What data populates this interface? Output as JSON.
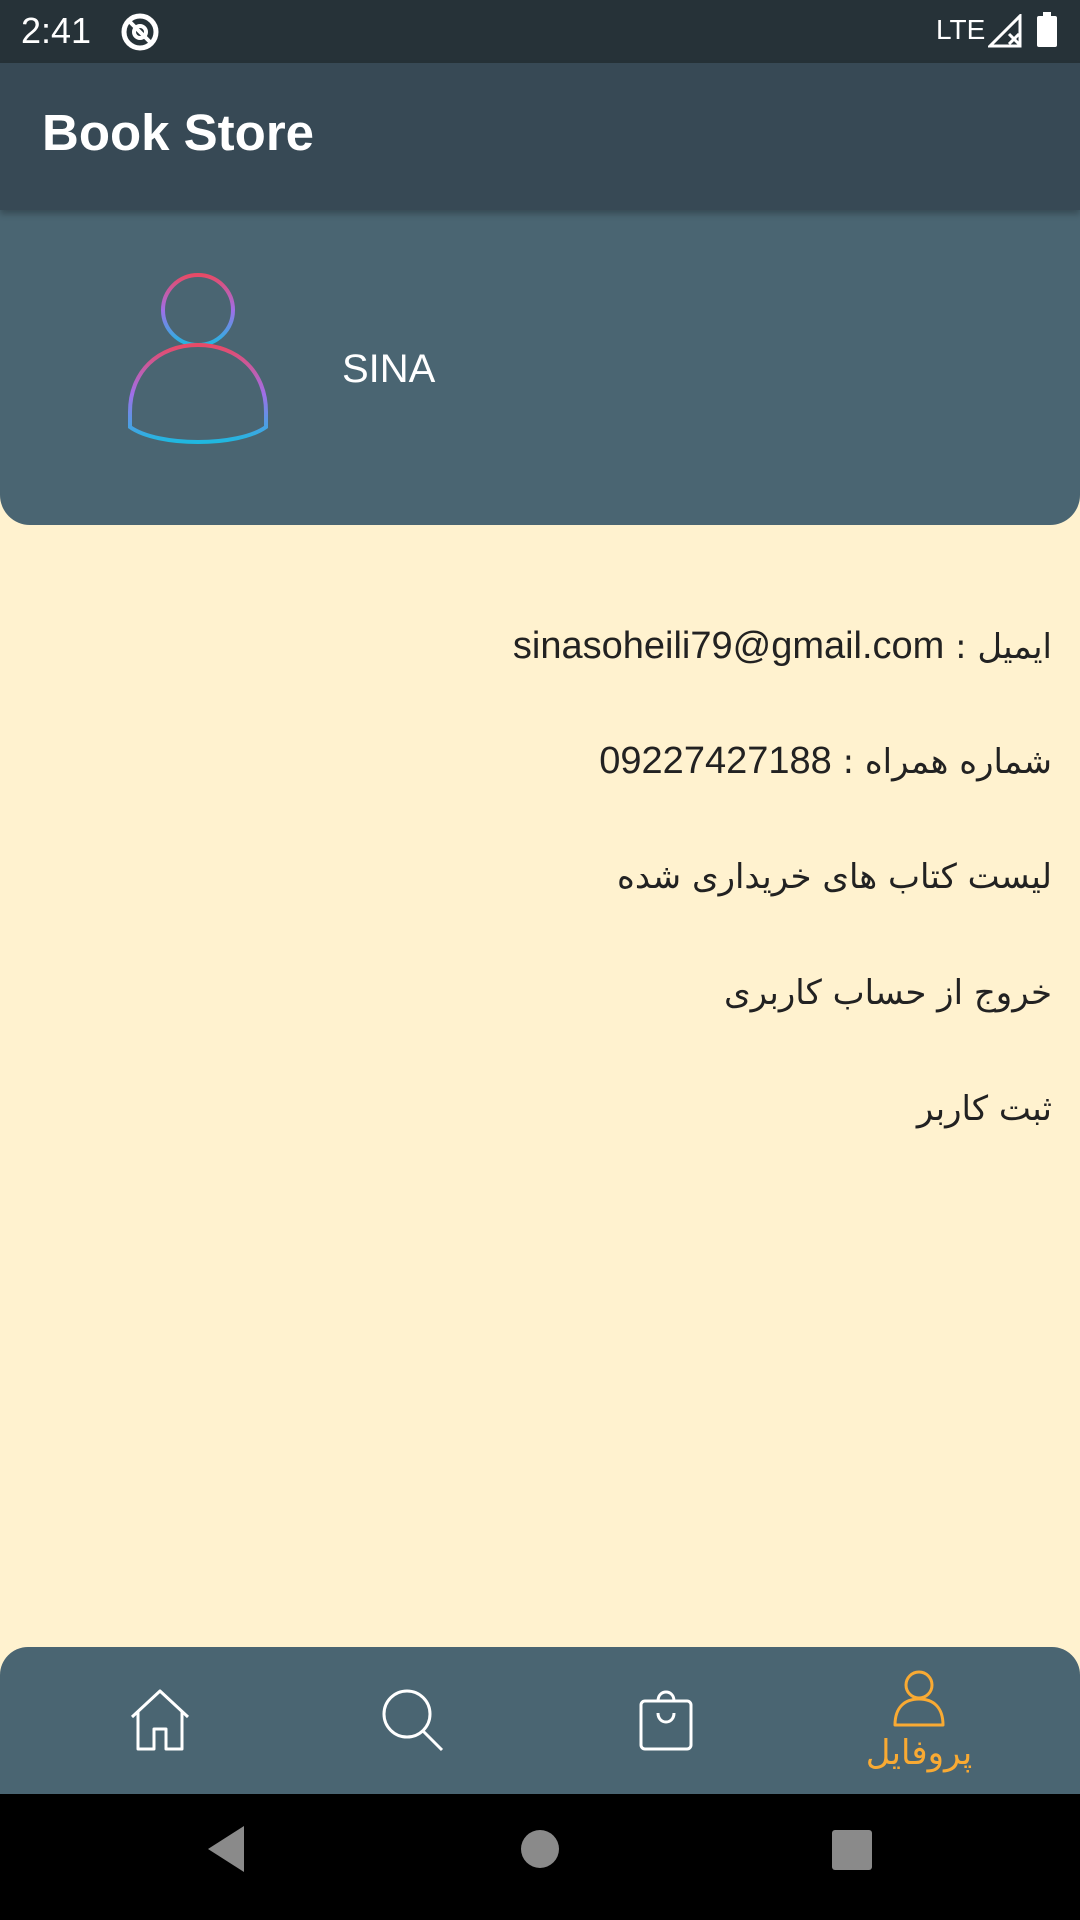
{
  "status_bar": {
    "time": "2:41",
    "network": "LTE",
    "icons": [
      "do-not-disturb-icon",
      "signal-icon",
      "battery-icon"
    ]
  },
  "app_bar": {
    "title": "Book Store"
  },
  "profile": {
    "name": "SINA",
    "avatar_icon": "user-avatar-icon"
  },
  "info": {
    "email_label": "ایمیل : ",
    "email_value": "sinasoheili79@gmail.com",
    "phone_label": "شماره همراه : ",
    "phone_value": "09227427188",
    "purchased_books": "لیست کتاب های خریداری شده",
    "logout": "خروج از حساب کاربری",
    "register": "ثبت کاربر"
  },
  "bottom_nav": {
    "items": [
      {
        "icon": "home-icon",
        "label": ""
      },
      {
        "icon": "search-icon",
        "label": ""
      },
      {
        "icon": "shopping-bag-icon",
        "label": ""
      },
      {
        "icon": "profile-icon",
        "label": "پروفایل",
        "active": true
      }
    ]
  },
  "colors": {
    "status_bar": "#263238",
    "app_bar": "#374955",
    "card": "#4a6572",
    "background": "#fff2cf",
    "accent": "#f9aa33"
  }
}
